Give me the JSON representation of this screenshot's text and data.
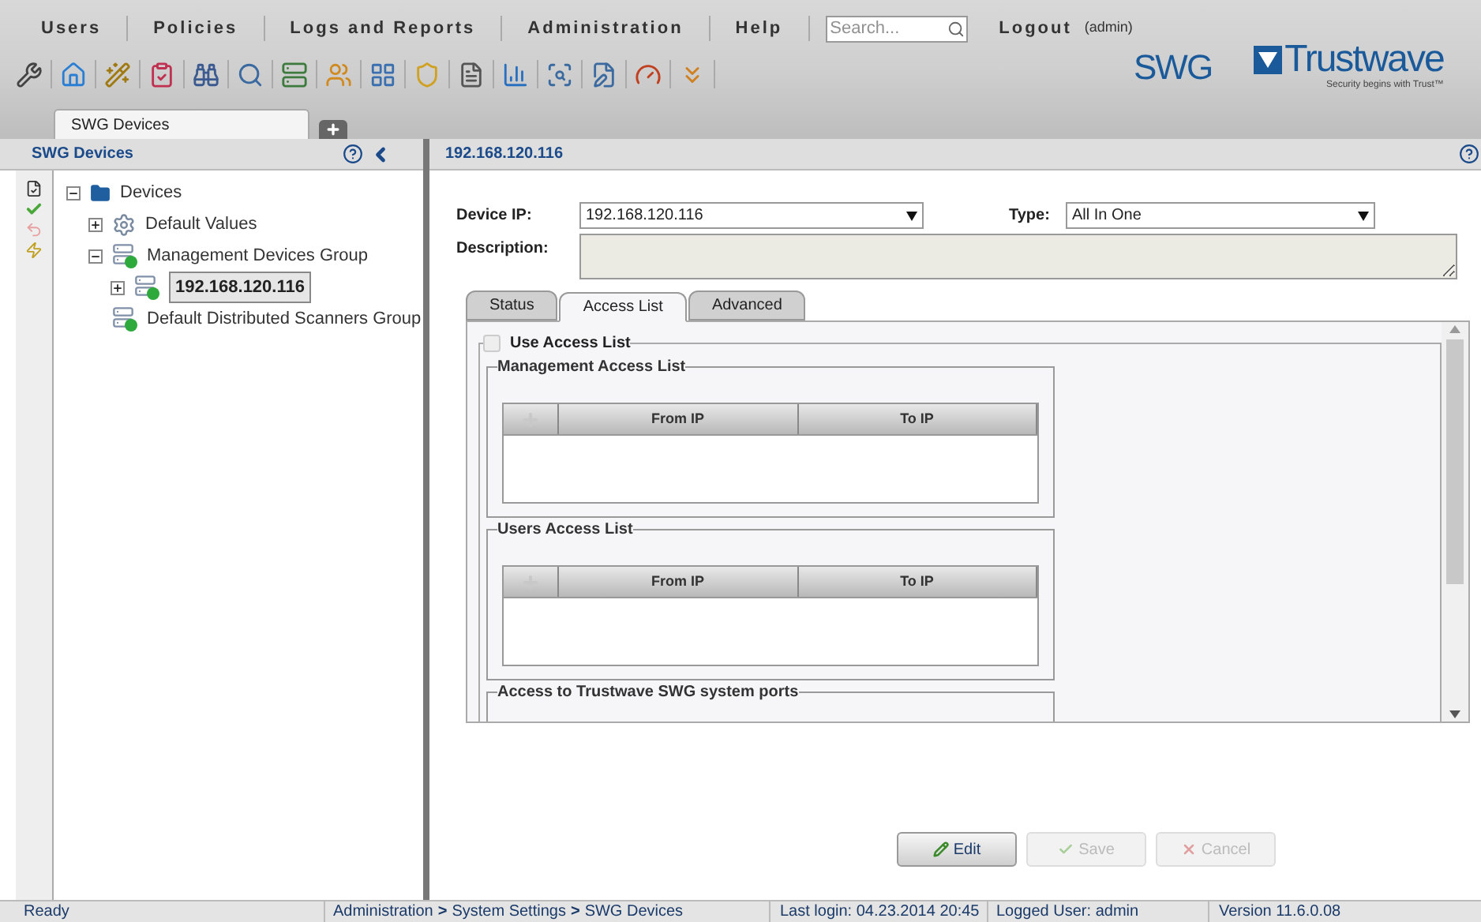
{
  "menu": [
    {
      "label": "Users"
    },
    {
      "label": "Policies"
    },
    {
      "label": "Logs and Reports"
    },
    {
      "label": "Administration"
    },
    {
      "label": "Help"
    }
  ],
  "search": {
    "placeholder": "Search..."
  },
  "logout": {
    "label": "Logout",
    "user": "(admin)"
  },
  "brand": {
    "product": "SWG",
    "name": "Trustwave",
    "tagline": "Security begins with Trust™"
  },
  "tabs": [
    {
      "label": "SWG Devices",
      "selected": true
    }
  ],
  "left_panel": {
    "title": "SWG Devices",
    "tree": [
      {
        "label": "Devices",
        "kind": "folder",
        "expanded": true,
        "selected": false,
        "children": [
          {
            "label": "Default Values",
            "kind": "settings",
            "expanded": false,
            "selected": false
          },
          {
            "label": "Management Devices Group",
            "kind": "group",
            "expanded": true,
            "selected": false,
            "children": [
              {
                "label": "192.168.120.116",
                "kind": "device",
                "expanded": false,
                "selected": true
              }
            ]
          },
          {
            "label": "Default Distributed Scanners Group",
            "kind": "group",
            "selected": false
          }
        ]
      }
    ]
  },
  "detail": {
    "title": "192.168.120.116",
    "device_ip": {
      "label": "Device IP:",
      "value": "192.168.120.116"
    },
    "type": {
      "label": "Type:",
      "value": "All In One"
    },
    "description": {
      "label": "Description:"
    },
    "tabs": [
      {
        "label": "Status",
        "selected": false
      },
      {
        "label": "Access List",
        "selected": true
      },
      {
        "label": "Advanced",
        "selected": false
      }
    ],
    "use_access_list": {
      "label": "Use Access List",
      "checked": false
    },
    "sections": [
      {
        "title": "Management Access List",
        "columns": [
          "From IP",
          "To IP"
        ]
      },
      {
        "title": "Users Access List",
        "columns": [
          "From IP",
          "To IP"
        ]
      },
      {
        "title": "Access to Trustwave SWG system ports"
      }
    ],
    "buttons": [
      {
        "label": "Edit",
        "kind": "edit",
        "disabled": false
      },
      {
        "label": "Save",
        "kind": "save",
        "disabled": true
      },
      {
        "label": "Cancel",
        "kind": "cancel",
        "disabled": true
      }
    ]
  },
  "status_bar": {
    "state": "Ready",
    "breadcrumb": [
      "Administration",
      "System Settings",
      "SWG Devices"
    ],
    "separator": ">",
    "last_login": "Last login: 04.23.2014 20:45",
    "logged_user": "Logged User: admin",
    "version": "Version 11.6.0.08"
  }
}
